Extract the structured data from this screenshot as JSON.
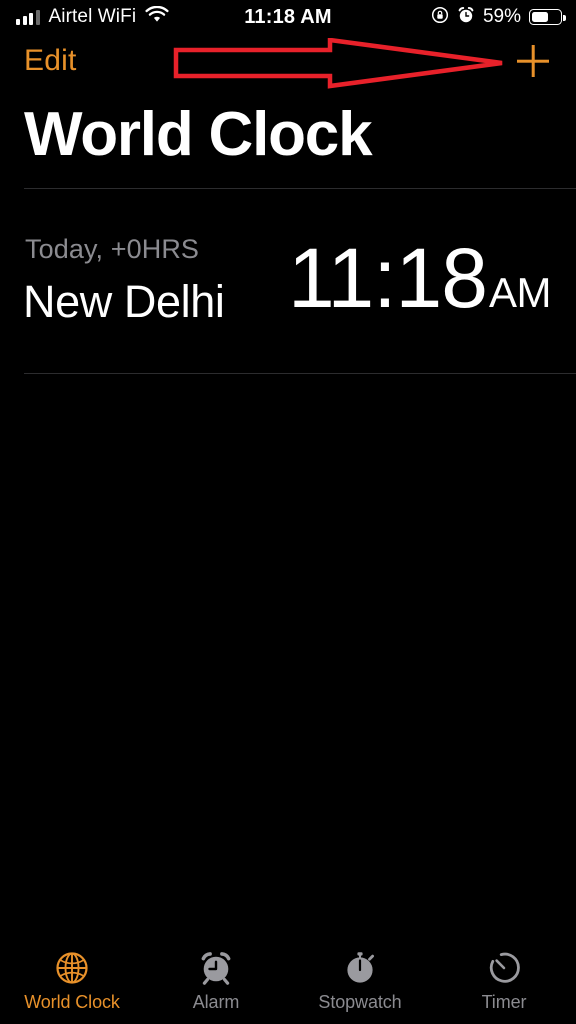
{
  "status_bar": {
    "carrier": "Airtel WiFi",
    "signal_icon": "cellular-bars-icon",
    "wifi_icon": "wifi-icon",
    "time": "11:18 AM",
    "rotation_lock_icon": "rotation-lock-icon",
    "alarm_icon": "alarm-indicator-icon",
    "battery_percent": "59%",
    "battery_level": 59,
    "battery_icon": "battery-icon"
  },
  "nav_bar": {
    "edit_label": "Edit",
    "add_icon": "plus-icon",
    "accent_color": "#E8912A"
  },
  "annotation": {
    "type": "arrow",
    "color": "#E8212A",
    "points_to": "add-button"
  },
  "header": {
    "title": "World Clock"
  },
  "clock_list": [
    {
      "offset": "Today, +0HRS",
      "city": "New Delhi",
      "time": "11:18",
      "meridiem": "AM"
    }
  ],
  "tab_bar": {
    "tabs": [
      {
        "label": "World Clock",
        "icon": "globe-icon",
        "active": true
      },
      {
        "label": "Alarm",
        "icon": "alarm-clock-icon",
        "active": false
      },
      {
        "label": "Stopwatch",
        "icon": "stopwatch-icon",
        "active": false
      },
      {
        "label": "Timer",
        "icon": "timer-icon",
        "active": false
      }
    ]
  },
  "colors": {
    "background": "#000000",
    "accent": "#E8912A",
    "secondary_text": "#8b8b90",
    "divider": "#2c2c2e",
    "annotation_red": "#E8212A"
  }
}
